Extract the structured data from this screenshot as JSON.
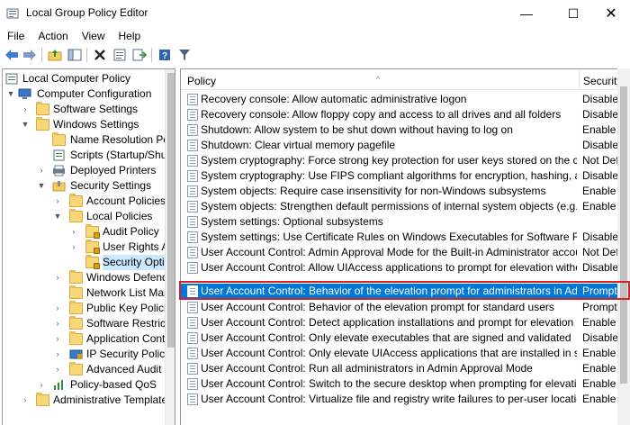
{
  "window": {
    "title": "Local Group Policy Editor",
    "controls": {
      "minimize": "—",
      "maximize": "☐",
      "close": "✕"
    }
  },
  "menu": [
    "File",
    "Action",
    "View",
    "Help"
  ],
  "toolbar": {
    "buttons": [
      "back-icon",
      "forward-icon",
      "up-folder-icon",
      "show-hide-tree-icon",
      "delete-icon",
      "properties-icon",
      "export-list-icon",
      "help-icon",
      "filter-icon"
    ]
  },
  "tree": {
    "items": [
      {
        "label": "Local Computer Policy",
        "icon": "computer-policy-icon"
      },
      {
        "label": "Computer Configuration",
        "icon": "computer-icon"
      },
      {
        "label": "Software Settings",
        "icon": "folder-icon"
      },
      {
        "label": "Windows Settings",
        "icon": "folder-icon"
      },
      {
        "label": "Name Resolution Pol",
        "icon": "folder-icon"
      },
      {
        "label": "Scripts (Startup/Shut",
        "icon": "scripts-icon"
      },
      {
        "label": "Deployed Printers",
        "icon": "printer-icon"
      },
      {
        "label": "Security Settings",
        "icon": "security-icon"
      },
      {
        "label": "Account Policies",
        "icon": "folder-icon"
      },
      {
        "label": "Local Policies",
        "icon": "folder-icon"
      },
      {
        "label": "Audit Policy",
        "icon": "locked-folder-icon"
      },
      {
        "label": "User Rights As",
        "icon": "locked-folder-icon"
      },
      {
        "label": "Security Optic",
        "icon": "locked-folder-icon"
      },
      {
        "label": "Windows Defend",
        "icon": "folder-icon"
      },
      {
        "label": "Network List Mar",
        "icon": "folder-icon"
      },
      {
        "label": "Public Key Policie",
        "icon": "folder-icon"
      },
      {
        "label": "Software Restricti",
        "icon": "folder-icon"
      },
      {
        "label": "Application Cont",
        "icon": "folder-icon"
      },
      {
        "label": "IP Security Policie",
        "icon": "ip-security-icon"
      },
      {
        "label": "Advanced Audit F",
        "icon": "folder-icon"
      },
      {
        "label": "Policy-based QoS",
        "icon": "qos-icon"
      },
      {
        "label": "Administrative Template",
        "icon": "folder-icon"
      }
    ]
  },
  "list": {
    "columns": {
      "policy": "Policy",
      "security": "Security"
    },
    "rows": [
      {
        "policy": "Recovery console: Allow automatic administrative logon",
        "setting": "Disable"
      },
      {
        "policy": "Recovery console: Allow floppy copy and access to all drives and all folders",
        "setting": "Disable"
      },
      {
        "policy": "Shutdown: Allow system to be shut down without having to log on",
        "setting": "Enable"
      },
      {
        "policy": "Shutdown: Clear virtual memory pagefile",
        "setting": "Disable"
      },
      {
        "policy": "System cryptography: Force strong key protection for user keys stored on the com...",
        "setting": "Not Def"
      },
      {
        "policy": "System cryptography: Use FIPS compliant algorithms for encryption, hashing, and ...",
        "setting": "Disable"
      },
      {
        "policy": "System objects: Require case insensitivity for non-Windows subsystems",
        "setting": "Enable"
      },
      {
        "policy": "System objects: Strengthen default permissions of internal system objects (e.g. Sy...",
        "setting": "Enable"
      },
      {
        "policy": "System settings: Optional subsystems",
        "setting": ""
      },
      {
        "policy": "System settings: Use Certificate Rules on Windows Executables for Software Restrict...",
        "setting": "Disable"
      },
      {
        "policy": "User Account Control: Admin Approval Mode for the Built-in Administrator account",
        "setting": "Not Def"
      },
      {
        "policy": "User Account Control: Allow UIAccess applications to prompt for elevation without...",
        "setting": "Disable"
      },
      {
        "policy": "User Account Control: Behavior of the elevation prompt for administrators in Admi...",
        "setting": "Prompt"
      },
      {
        "policy": "User Account Control: Behavior of the elevation prompt for standard users",
        "setting": "Prompt"
      },
      {
        "policy": "User Account Control: Detect application installations and prompt for elevation",
        "setting": "Enable"
      },
      {
        "policy": "User Account Control: Only elevate executables that are signed and validated",
        "setting": "Disable"
      },
      {
        "policy": "User Account Control: Only elevate UIAccess applications that are installed in secur...",
        "setting": "Enable"
      },
      {
        "policy": "User Account Control: Run all administrators in Admin Approval Mode",
        "setting": "Enable"
      },
      {
        "policy": "User Account Control: Switch to the secure desktop when prompting for elevation",
        "setting": "Enable"
      },
      {
        "policy": "User Account Control: Virtualize file and registry write failures to per-user locations",
        "setting": "Enable"
      }
    ]
  },
  "colors": {
    "selection": "#0078d7",
    "highlight_outline": "#d3222a",
    "tree_selection": "#cce8ff"
  }
}
